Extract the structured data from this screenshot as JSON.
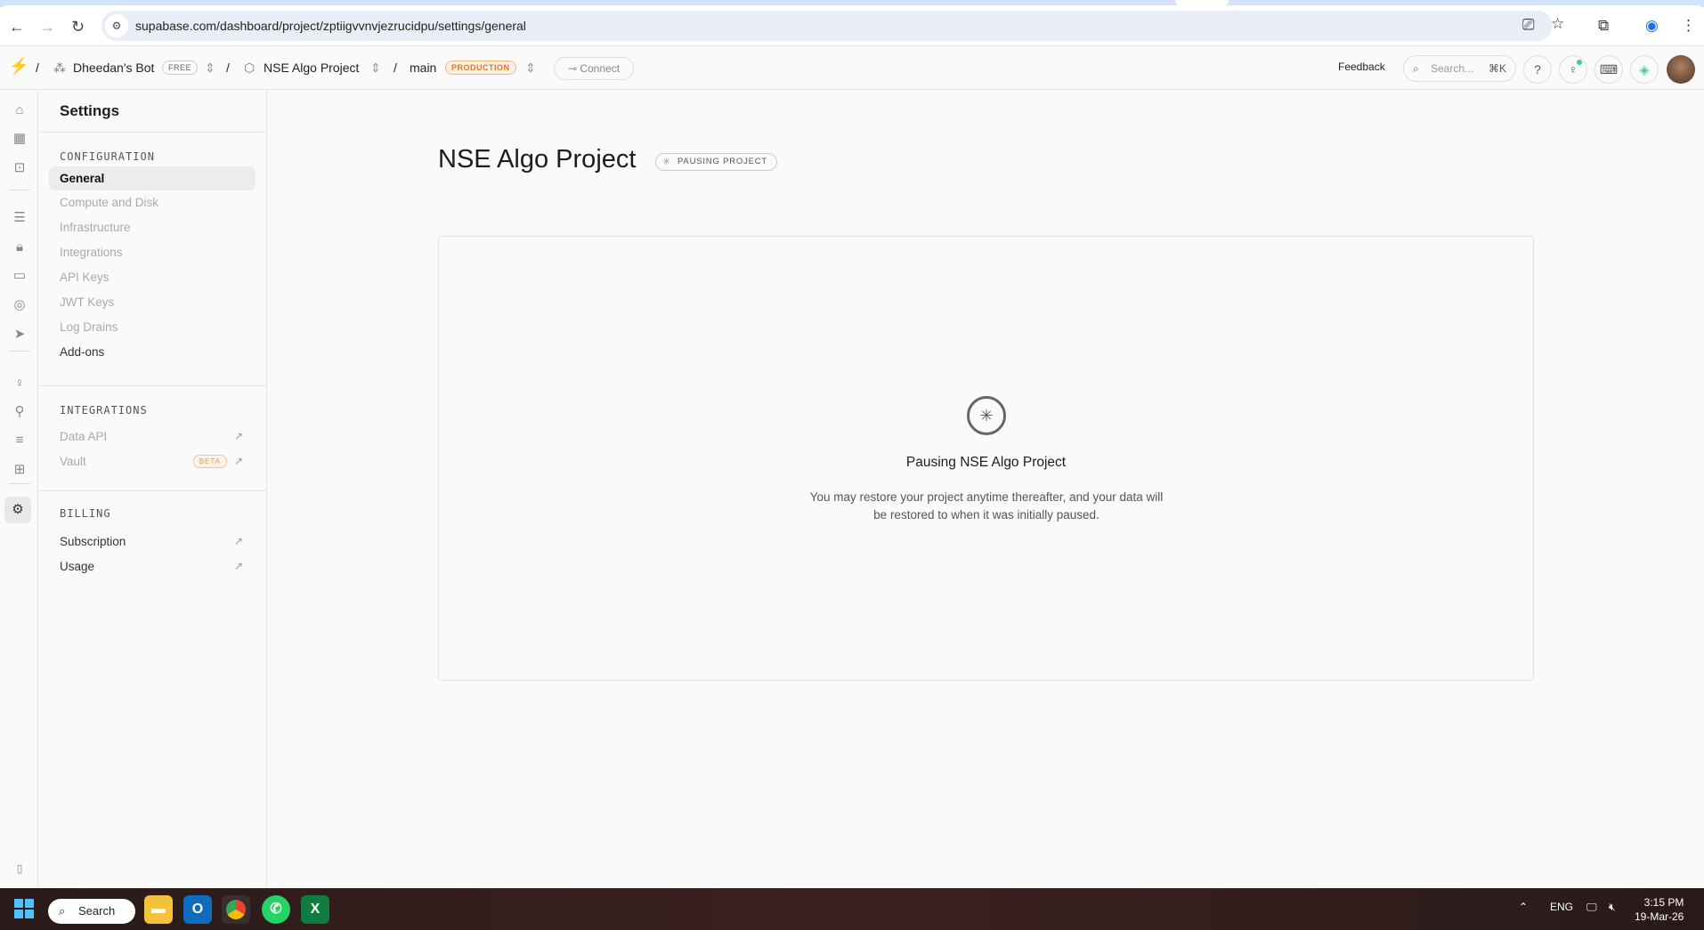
{
  "browser": {
    "url": "supabase.com/dashboard/project/zptiigvvnvjezrucidpu/settings/general"
  },
  "header": {
    "org_name": "Dheedan's Bot",
    "org_plan": "FREE",
    "project_name": "NSE Algo Project",
    "branch": "main",
    "branch_badge": "PRODUCTION",
    "connect_label": "Connect",
    "feedback_label": "Feedback",
    "search_placeholder": "Search...",
    "search_shortcut": "⌘K"
  },
  "sidebar": {
    "title": "Settings",
    "sections": [
      {
        "label": "CONFIGURATION",
        "items": [
          "General",
          "Compute and Disk",
          "Infrastructure",
          "Integrations",
          "API Keys",
          "JWT Keys",
          "Log Drains",
          "Add-ons"
        ]
      },
      {
        "label": "INTEGRATIONS",
        "items": [
          "Data API",
          "Vault"
        ],
        "vault_badge": "BETA"
      },
      {
        "label": "BILLING",
        "items": [
          "Subscription",
          "Usage"
        ]
      }
    ]
  },
  "main": {
    "title": "NSE Algo Project",
    "status_badge": "PAUSING PROJECT",
    "card_title": "Pausing NSE Algo Project",
    "card_description": "You may restore your project anytime thereafter, and your data will be restored to when it was initially paused."
  },
  "taskbar": {
    "search_label": "Search",
    "language": "ENG",
    "time": "3:15 PM",
    "date": "19-Mar-26"
  },
  "colors": {
    "brand": "#3ecf8e",
    "production": "#d67a2a",
    "windows": "#4cc2ff"
  }
}
